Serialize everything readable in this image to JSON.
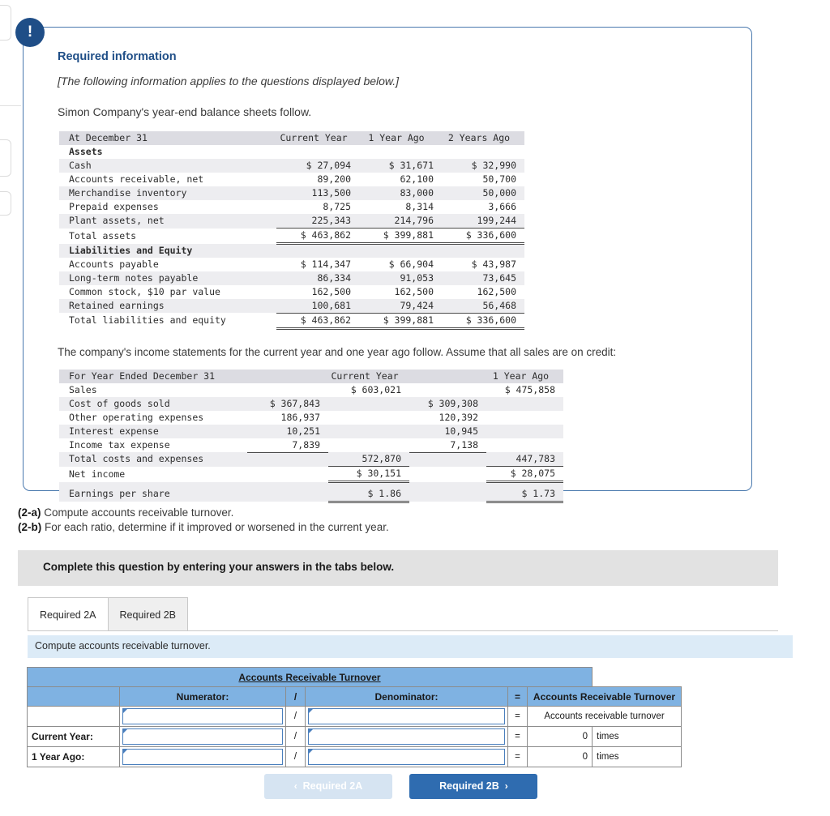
{
  "panel": {
    "badge_icon": "exclamation-icon",
    "badge_glyph": "!",
    "title": "Required information",
    "subtitle": "[The following information applies to the questions displayed below.]",
    "intro": "Simon Company's year-end balance sheets follow.",
    "mid_text": "The company's income statements for the current year and one year ago follow. Assume that all sales are on credit:"
  },
  "balance_sheet": {
    "headers": [
      "At December 31",
      "Current Year",
      "1 Year Ago",
      "2 Years Ago"
    ],
    "section_assets": "Assets",
    "asset_rows": [
      {
        "label": "Cash",
        "values": [
          "$ 27,094",
          "$ 31,671",
          "$ 32,990"
        ]
      },
      {
        "label": "Accounts receivable, net",
        "values": [
          "89,200",
          "62,100",
          "50,700"
        ]
      },
      {
        "label": "Merchandise inventory",
        "values": [
          "113,500",
          "83,000",
          "50,000"
        ]
      },
      {
        "label": "Prepaid expenses",
        "values": [
          "8,725",
          "8,314",
          "3,666"
        ]
      },
      {
        "label": "Plant assets, net",
        "values": [
          "225,343",
          "214,796",
          "199,244"
        ]
      }
    ],
    "total_assets": {
      "label": "Total assets",
      "values": [
        "$ 463,862",
        "$ 399,881",
        "$ 336,600"
      ]
    },
    "section_liab": "Liabilities and Equity",
    "liab_rows": [
      {
        "label": "Accounts payable",
        "values": [
          "$ 114,347",
          "$ 66,904",
          "$ 43,987"
        ]
      },
      {
        "label": "Long-term notes payable",
        "values": [
          "86,334",
          "91,053",
          "73,645"
        ]
      },
      {
        "label": "Common stock, $10 par value",
        "values": [
          "162,500",
          "162,500",
          "162,500"
        ]
      },
      {
        "label": "Retained earnings",
        "values": [
          "100,681",
          "79,424",
          "56,468"
        ]
      }
    ],
    "total_liab": {
      "label": "Total liabilities and equity",
      "values": [
        "$ 463,862",
        "$ 399,881",
        "$ 336,600"
      ]
    }
  },
  "income_statement": {
    "headers": [
      "For Year Ended December 31",
      "Current Year",
      "1 Year Ago"
    ],
    "rows": {
      "sales": {
        "label": "Sales",
        "cy_total": "$ 603,021",
        "py_total": "$ 475,858"
      },
      "cogs": {
        "label": "Cost of goods sold",
        "cy_detail": "$ 367,843",
        "py_detail": "$ 309,308"
      },
      "other_op": {
        "label": "Other operating expenses",
        "cy_detail": "186,937",
        "py_detail": "120,392"
      },
      "interest": {
        "label": "Interest expense",
        "cy_detail": "10,251",
        "py_detail": "10,945"
      },
      "tax": {
        "label": "Income tax expense",
        "cy_detail": "7,839",
        "py_detail": "7,138"
      },
      "total_costs": {
        "label": "Total costs and expenses",
        "cy_total": "572,870",
        "py_total": "447,783"
      },
      "net_income": {
        "label": "Net income",
        "cy_total": "$ 30,151",
        "py_total": "$ 28,075"
      },
      "eps": {
        "label": "Earnings per share",
        "cy_total": "$ 1.86",
        "py_total": "$ 1.73"
      }
    }
  },
  "requirements": {
    "q_a_num": "(2-a)",
    "q_a_text": " Compute accounts receivable turnover.",
    "q_b_num": "(2-b)",
    "q_b_text": " For each ratio, determine if it improved or worsened in the current year."
  },
  "banner": {
    "text": "Complete this question by entering your answers in the tabs below."
  },
  "tabs": {
    "active": "Required 2A",
    "inactive": "Required 2B"
  },
  "instruction": {
    "text": "Compute accounts receivable turnover."
  },
  "answer_table": {
    "title": "Accounts Receivable Turnover",
    "col_numerator": "Numerator:",
    "col_slash": "/",
    "col_denominator": "Denominator:",
    "col_equals": "=",
    "col_result": "Accounts Receivable Turnover",
    "rows": [
      {
        "label": "",
        "numerator_value": "",
        "slash": "/",
        "denominator_value": "",
        "equals": "=",
        "result_text": "Accounts receivable turnover",
        "result_value": "",
        "result_unit": ""
      },
      {
        "label": "Current Year:",
        "numerator_value": "",
        "slash": "/",
        "denominator_value": "",
        "equals": "=",
        "result_text": "",
        "result_value": "0",
        "result_unit": "times"
      },
      {
        "label": "1 Year Ago:",
        "numerator_value": "",
        "slash": "/",
        "denominator_value": "",
        "equals": "=",
        "result_text": "",
        "result_value": "0",
        "result_unit": "times"
      }
    ]
  },
  "nav": {
    "prev_label": "Required 2A",
    "prev_chevron": "‹",
    "next_label": "Required 2B",
    "next_chevron": "›"
  },
  "colors": {
    "panel_border": "#4a79ae",
    "badge": "#1f4e87",
    "title": "#1f4e87",
    "table_header_blue": "#7fb2e2",
    "instruction_blue": "#dcebf7",
    "banner_gray": "#e2e2e2",
    "next_button": "#2f6cb0",
    "prev_button": "#d6e4f2",
    "field_border": "#4a7fbd"
  }
}
